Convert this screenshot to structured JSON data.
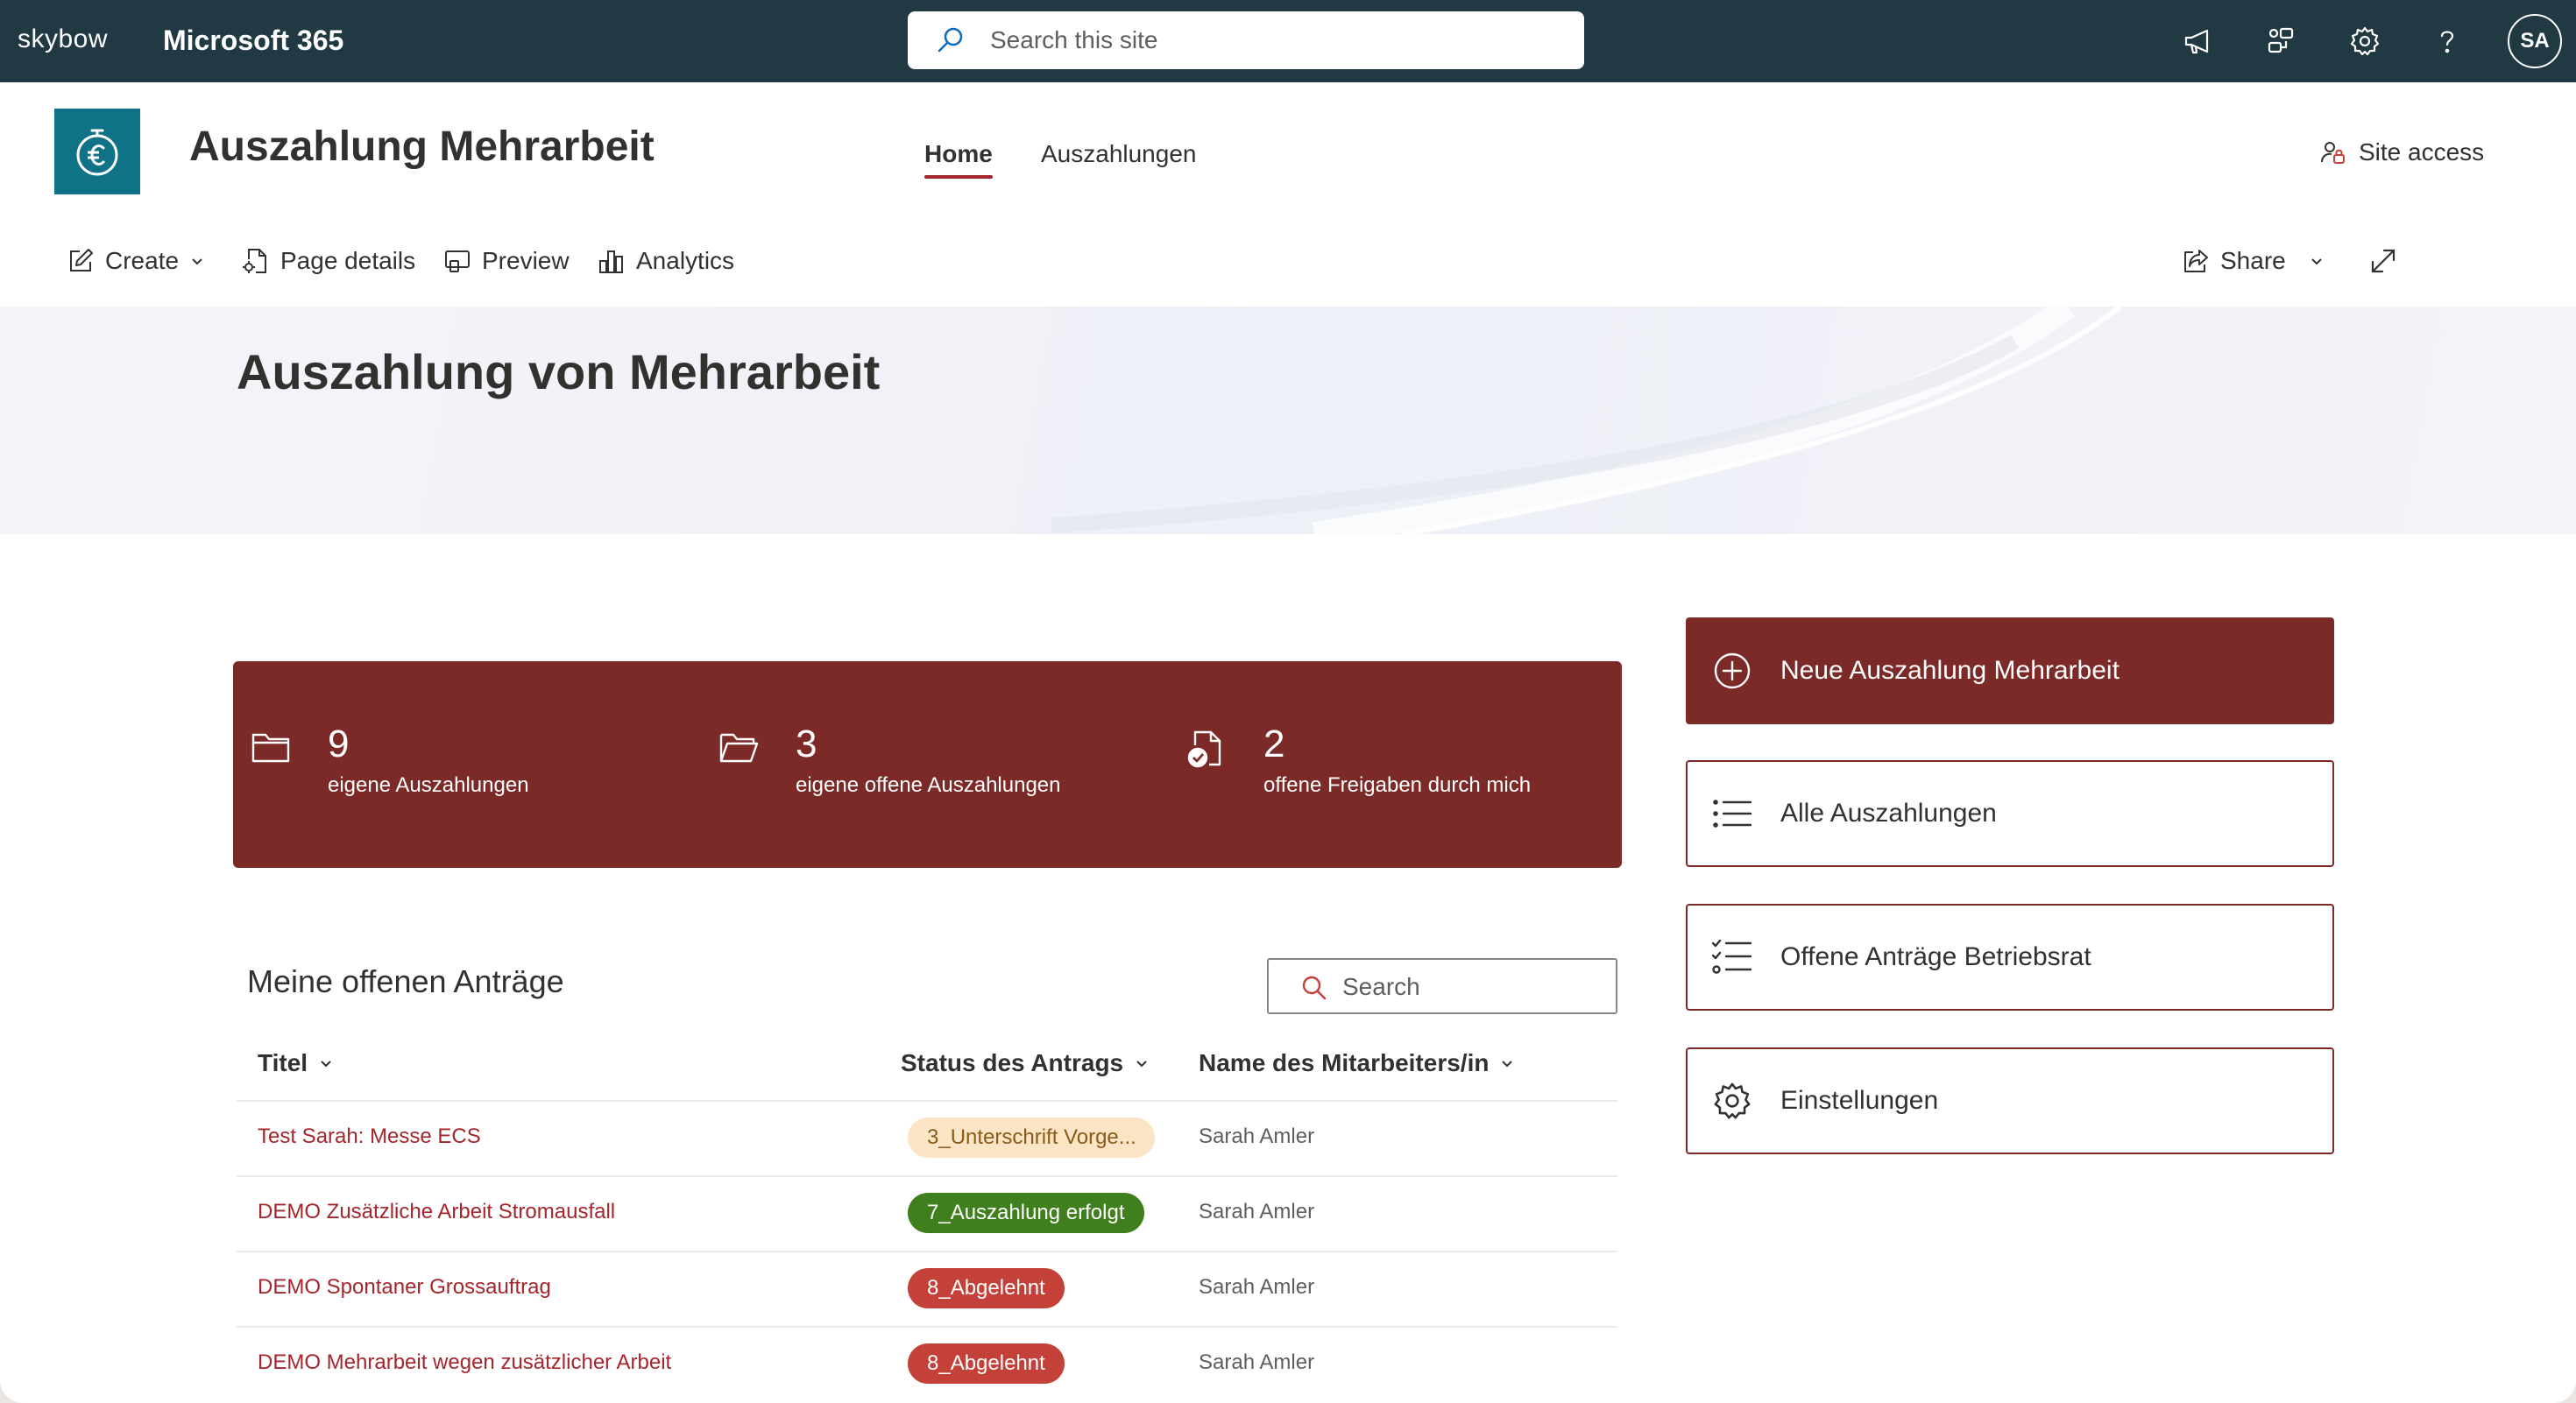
{
  "suitebar": {
    "brand": "skybow",
    "app_title": "Microsoft 365",
    "search_placeholder": "Search this site",
    "icons": [
      "megaphone-icon",
      "app-connections-icon",
      "settings-gear-icon",
      "help-question-icon"
    ],
    "avatar_initials": "SA"
  },
  "site": {
    "title": "Auszahlung Mehrarbeit",
    "logo_icon": "euro-clock-icon",
    "nav": [
      {
        "label": "Home",
        "active": true
      },
      {
        "label": "Auszahlungen",
        "active": false
      }
    ],
    "site_access": "Site access"
  },
  "commandbar": {
    "create": "Create",
    "page_details": "Page details",
    "preview": "Preview",
    "analytics": "Analytics",
    "share": "Share"
  },
  "hero": {
    "title": "Auszahlung von Mehrarbeit"
  },
  "stats": [
    {
      "icon": "folder-icon",
      "value": "9",
      "label": "eigene Auszahlungen"
    },
    {
      "icon": "open-folder-icon",
      "value": "3",
      "label": "eigene offene Auszahlungen"
    },
    {
      "icon": "document-check-icon",
      "value": "2",
      "label": "offene Freigaben durch mich"
    }
  ],
  "actions": [
    {
      "label": "Neue Auszahlung Mehrarbeit",
      "icon": "add-circle-icon",
      "primary": true
    },
    {
      "label": "Alle Auszahlungen",
      "icon": "list-icon",
      "primary": false
    },
    {
      "label": "Offene Anträge Betriebsrat",
      "icon": "checklist-icon",
      "primary": false
    },
    {
      "label": "Einstellungen",
      "icon": "settings-gear-icon",
      "primary": false
    }
  ],
  "list": {
    "title": "Meine offenen Anträge",
    "search_placeholder": "Search",
    "columns": [
      "Titel",
      "Status des Antrags",
      "Name des Mitarbeiters/in"
    ],
    "rows": [
      {
        "title": "Test Sarah: Messe ECS",
        "status": "3_Unterschrift Vorge...",
        "name": "Sarah Amler"
      },
      {
        "title": "DEMO Zusätzliche Arbeit Stromausfall",
        "status": "7_Auszahlung erfolgt",
        "name": "Sarah Amler"
      },
      {
        "title": "DEMO Spontaner Grossauftrag",
        "status": "8_Abgelehnt",
        "name": "Sarah Amler"
      },
      {
        "title": "DEMO Mehrarbeit wegen zusätzlicher Arbeit",
        "status": "8_Abgelehnt",
        "name": "Sarah Amler"
      }
    ]
  },
  "colors": {
    "suitebar_bg": "#203942",
    "brand_dark_red": "#7b2a27",
    "logo_teal": "#0f7287",
    "link_red": "#a4262c",
    "status_pending_bg": "#fce5c4",
    "status_success_bg": "#407f1d",
    "status_rejected_bg": "#c4413a"
  }
}
